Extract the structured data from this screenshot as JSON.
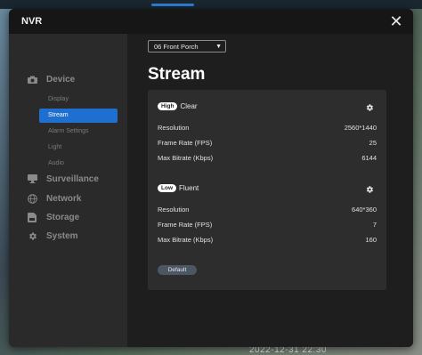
{
  "app": {
    "title": "NVR"
  },
  "background": {
    "timestamp": "2022-12-31 22:30"
  },
  "channel": {
    "selected": "06  Front Porch"
  },
  "page": {
    "title": "Stream"
  },
  "sidebar": {
    "categories": [
      {
        "label": "Device",
        "icon": "camera-icon"
      },
      {
        "label": "Surveillance",
        "icon": "monitor-icon"
      },
      {
        "label": "Network",
        "icon": "globe-icon"
      },
      {
        "label": "Storage",
        "icon": "storage-icon"
      },
      {
        "label": "System",
        "icon": "gear-icon"
      }
    ],
    "device_items": [
      {
        "label": "Display",
        "active": false
      },
      {
        "label": "Stream",
        "active": true
      },
      {
        "label": "Alarm Settings",
        "active": false
      },
      {
        "label": "Light",
        "active": false
      },
      {
        "label": "Audio",
        "active": false
      }
    ]
  },
  "streams": {
    "high": {
      "badge": "High",
      "name": "Clear",
      "rows": [
        {
          "label": "Resolution",
          "value": "2560*1440"
        },
        {
          "label": "Frame Rate (FPS)",
          "value": "25"
        },
        {
          "label": "Max Bitrate (Kbps)",
          "value": "6144"
        }
      ]
    },
    "low": {
      "badge": "Low",
      "name": "Fluent",
      "rows": [
        {
          "label": "Resolution",
          "value": "640*360"
        },
        {
          "label": "Frame Rate (FPS)",
          "value": "7"
        },
        {
          "label": "Max Bitrate (Kbps)",
          "value": "160"
        }
      ]
    }
  },
  "actions": {
    "default_label": "Default"
  },
  "colors": {
    "accent": "#1f6fd1",
    "dialog_bg": "#1e1e1e",
    "sidebar_bg": "#2a2a2a",
    "panel_bg": "#2d2d2d"
  }
}
